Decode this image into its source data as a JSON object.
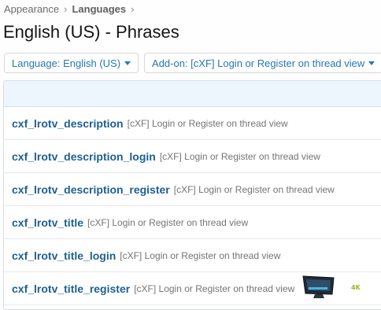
{
  "breadcrumb": {
    "items": [
      "Appearance",
      "Languages"
    ]
  },
  "page_title": "English (US) - Phrases",
  "filters": {
    "language_label": "Language: English (US)",
    "addon_label": "Add-on: [cXF] Login or Register on thread view"
  },
  "phrases": [
    {
      "name": "cxf_lrotv_description",
      "addon": "[cXF] Login or Register on thread view"
    },
    {
      "name": "cxf_lrotv_description_login",
      "addon": "[cXF] Login or Register on thread view"
    },
    {
      "name": "cxf_lrotv_description_register",
      "addon": "[cXF] Login or Register on thread view"
    },
    {
      "name": "cxf_lrotv_title",
      "addon": "[cXF] Login or Register on thread view"
    },
    {
      "name": "cxf_lrotv_title_login",
      "addon": "[cXF] Login or Register on thread view"
    },
    {
      "name": "cxf_lrotv_title_register",
      "addon": "[cXF] Login or Register on thread view"
    }
  ],
  "overlay": {
    "badge_text": "4K",
    "icon": "monitor-icon"
  },
  "colors": {
    "link": "#2577b1",
    "phrase_name": "#1d5f93",
    "header_bg": "#edf6fd",
    "badge": "#9ab622"
  }
}
